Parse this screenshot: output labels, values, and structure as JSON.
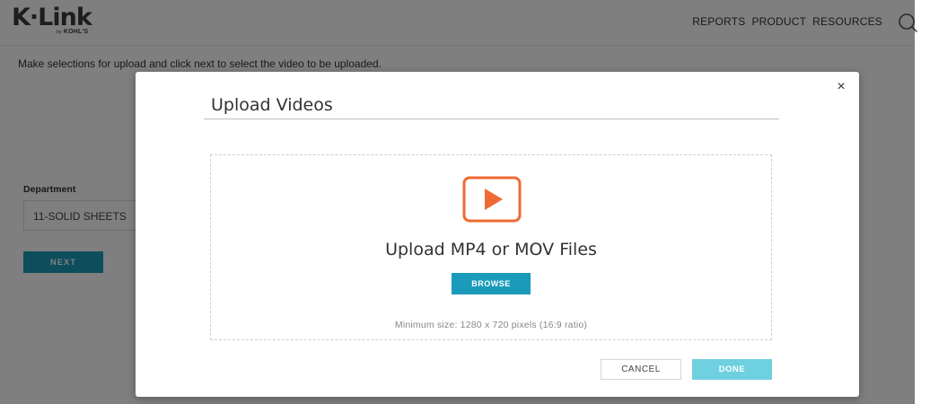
{
  "header": {
    "logo_main": "K·Link",
    "logo_by": "by",
    "logo_sub": "KOHL'S",
    "nav": [
      "REPORTS",
      "PRODUCT",
      "RESOURCES"
    ],
    "search_icon": "search-icon"
  },
  "page": {
    "instruction": "Make selections for upload and click next to select the video to be uploaded.",
    "department_label": "Department",
    "department_value": "11-SOLID SHEETS",
    "next_label": "NEXT"
  },
  "modal": {
    "title": "Upload Videos",
    "close_label": "×",
    "drop_heading": "Upload MP4 or MOV Files",
    "browse_label": "BROWSE",
    "min_size": "Minimum size: 1280 x 720 pixels (16:9 ratio)",
    "cancel_label": "CANCEL",
    "done_label": "DONE",
    "play_icon": "play-icon"
  },
  "colors": {
    "accent": "#1a9bb9",
    "done_disabled": "#6fd0df",
    "play_orange": "#ef6a33"
  }
}
